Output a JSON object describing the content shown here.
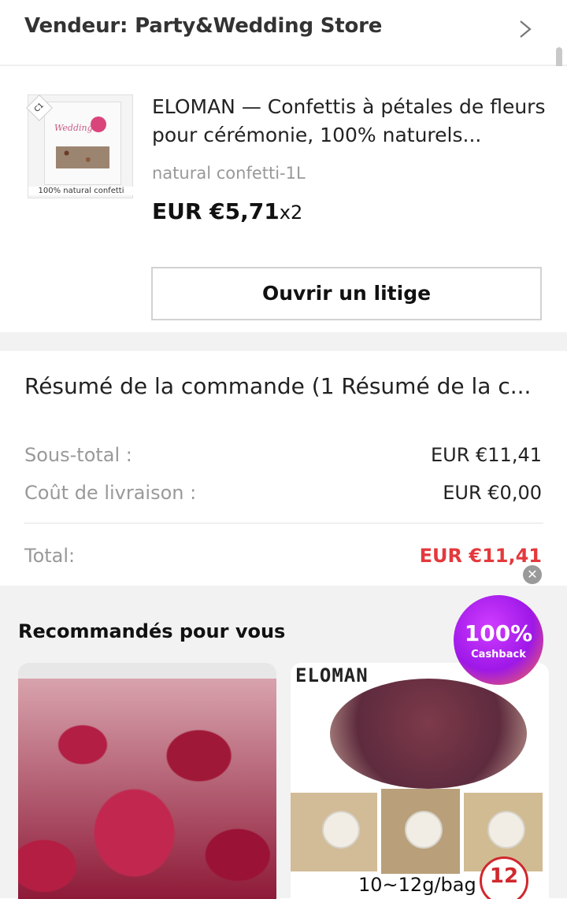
{
  "seller": {
    "label": "Vendeur: Party&Wedding Store"
  },
  "product": {
    "thumb_caption": "100% natural confetti",
    "thumb_bag_label": "Wedding",
    "thumb_tag": "C1",
    "title": "ELOMAN — Confettis à pétales de fleurs pour cérémonie, 100% naturels...",
    "variant": "natural confetti-1L",
    "price": "EUR €5,71",
    "quantity": "x2",
    "dispute_button": "Ouvrir un litige"
  },
  "summary": {
    "title": "Résumé de la commande (1 Résumé de la c...",
    "subtotal_label": "Sous-total :",
    "subtotal_value": "EUR €11,41",
    "shipping_label": "Coût de livraison :",
    "shipping_value": "EUR €0,00",
    "total_label": "Total:",
    "total_value": "EUR €11,41"
  },
  "recommendations": {
    "title": "Recommandés pour vous",
    "cashback_pct": "100%",
    "cashback_label": "Cashback",
    "card2_brand": "ELOMAN",
    "card2_weight": "10~12g/bag",
    "card2_badge": "12"
  },
  "colors": {
    "accent_red": "#e4393c",
    "muted_text": "#999999",
    "background_gray": "#f2f2f2"
  }
}
